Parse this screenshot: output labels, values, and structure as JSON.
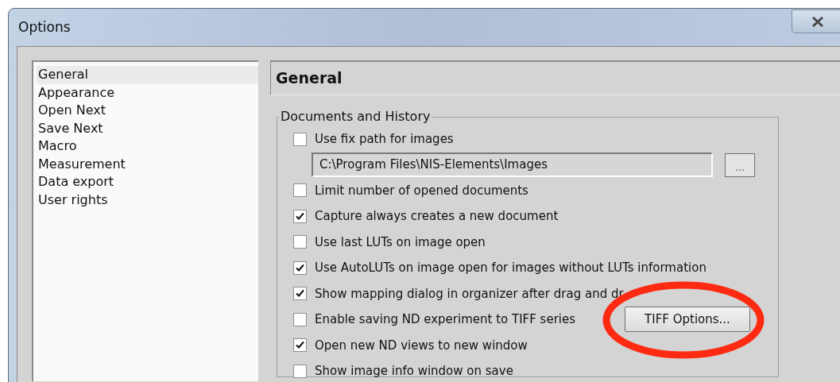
{
  "window": {
    "title": "Options"
  },
  "sidebar": {
    "items": [
      {
        "label": "General",
        "selected": true
      },
      {
        "label": "Appearance",
        "selected": false
      },
      {
        "label": "Open Next",
        "selected": false
      },
      {
        "label": "Save Next",
        "selected": false
      },
      {
        "label": "Macro",
        "selected": false
      },
      {
        "label": "Measurement",
        "selected": false
      },
      {
        "label": "Data export",
        "selected": false
      },
      {
        "label": "User rights",
        "selected": false
      }
    ]
  },
  "page": {
    "title": "General",
    "group": {
      "title": "Documents and History",
      "rows": [
        {
          "kind": "checkbox",
          "label": "Use fix path for images",
          "checked": false
        },
        {
          "kind": "path",
          "value": "C:\\Program Files\\NIS-Elements\\Images",
          "button": "..."
        },
        {
          "kind": "checkbox",
          "label": "Limit number of opened documents",
          "checked": false
        },
        {
          "kind": "checkbox",
          "label": "Capture always creates a new document",
          "checked": true
        },
        {
          "kind": "checkbox",
          "label": "Use last LUTs on image open",
          "checked": false
        },
        {
          "kind": "checkbox",
          "label": "Use AutoLUTs on image open for images without LUTs information",
          "checked": true
        },
        {
          "kind": "checkbox",
          "label": "Show mapping dialog in organizer after drag and dr",
          "checked": true
        },
        {
          "kind": "checkbox",
          "label": "Enable saving ND experiment to TIFF series",
          "checked": false,
          "button": "TIFF Options..."
        },
        {
          "kind": "checkbox",
          "label": "Open new ND views to new window",
          "checked": true
        },
        {
          "kind": "checkbox",
          "label": "Show image info window on save",
          "checked": false
        }
      ]
    }
  },
  "annotation": {
    "kind": "ellipse",
    "color": "#ff2a12"
  }
}
